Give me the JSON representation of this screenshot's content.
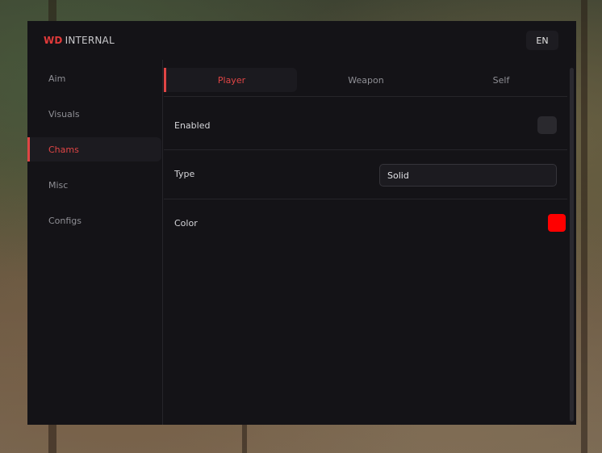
{
  "header": {
    "brand_accent": "WD",
    "brand_rest": "INTERNAL",
    "language": "EN"
  },
  "sidebar": {
    "items": [
      {
        "label": "Aim"
      },
      {
        "label": "Visuals"
      },
      {
        "label": "Chams"
      },
      {
        "label": "Misc"
      },
      {
        "label": "Configs"
      }
    ],
    "active_index": 2
  },
  "tabs": {
    "items": [
      {
        "label": "Player"
      },
      {
        "label": "Weapon"
      },
      {
        "label": "Self"
      }
    ],
    "active_index": 0
  },
  "settings": {
    "enabled": {
      "label": "Enabled",
      "checked": false
    },
    "type": {
      "label": "Type",
      "value": "Solid"
    },
    "color": {
      "label": "Color",
      "value": "#ff0000"
    }
  },
  "theme": {
    "accent": "#e04545",
    "window_bg": "#141317"
  }
}
